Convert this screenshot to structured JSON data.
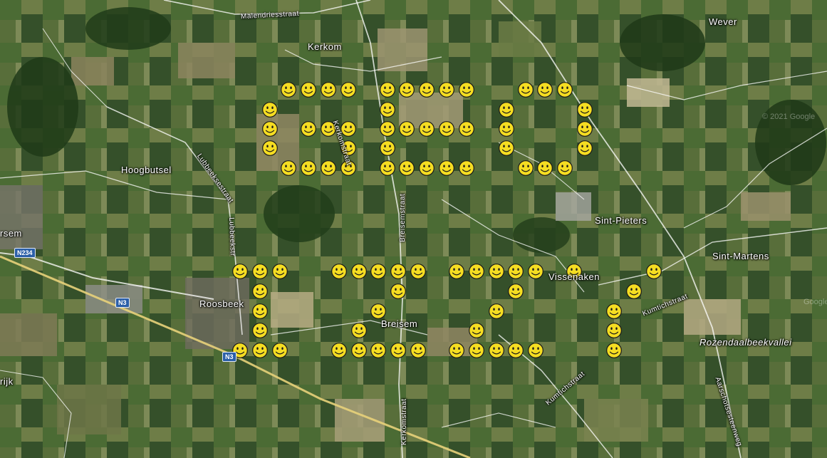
{
  "map": {
    "places": {
      "kerkom": "Kerkom",
      "wever": "Wever",
      "hoogbutsel": "Hoogbutsel",
      "sint_pieters": "Sint-Pieters",
      "sint_martens": "Sint-Martens",
      "roosbeek": "Roosbeek",
      "breisem": "Breisem",
      "vissenaken": "Vissenaken",
      "rsem": "rsem",
      "rijk": "rijk",
      "rozendaalbeekvallei": "Rozendaalbeekvallei"
    },
    "streets": {
      "malendriesstraat": "Malendriesstraat",
      "kerkomstraat_north": "Kerkomstraat",
      "lubbeekse_north": "Lubbeeksestraat",
      "lubbeekse_south": "Lubbeekstr",
      "breisem_street": "Breisemstraat",
      "kerkomstraat_south": "Kerkomstraat",
      "kumtichstraat_east": "Kumtichstraat",
      "kumtichstraat_south": "Kumtichstraat",
      "aarschotsesteenweg": "Aarschotsesteenweg"
    },
    "roads": {
      "n234": "N234",
      "n3_a": "N3",
      "n3_b": "N3"
    },
    "watermarks": {
      "copyright": "© 2021 Google",
      "google": "Google"
    }
  },
  "smiley_icon": "smiley-face-icon",
  "colors": {
    "smiley_fill": "#f5dd22",
    "smiley_stroke": "#1a1a1a",
    "road": "#ffffff"
  },
  "letters": [
    "C",
    "E",
    "O",
    "L",
    "I",
    "F",
    "E",
    "'"
  ]
}
